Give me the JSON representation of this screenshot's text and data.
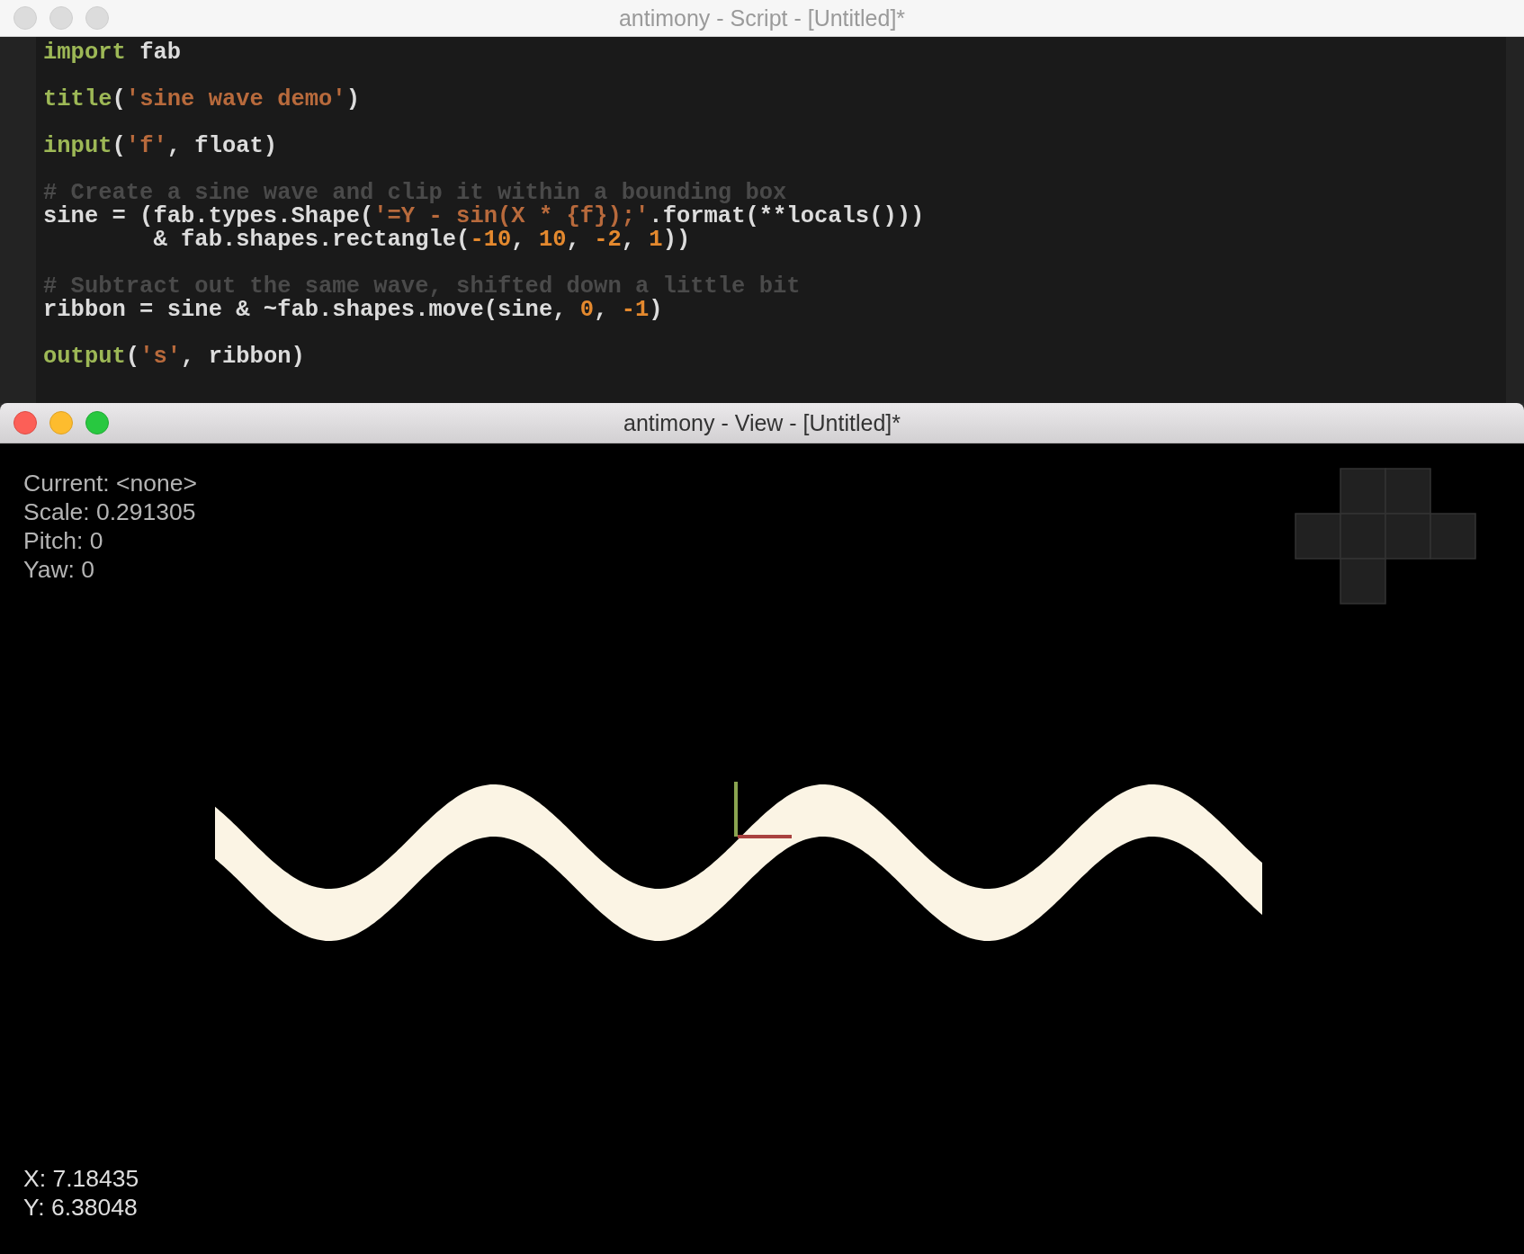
{
  "script_window": {
    "title": "antimony - Script - [Untitled]*",
    "active": false,
    "code_blocks": [
      {
        "lines": [
          {
            "tokens": [
              {
                "kind": "keyword",
                "text": "import"
              },
              {
                "kind": "plain",
                "text": " fab"
              }
            ]
          }
        ]
      },
      {
        "lines": [
          {
            "tokens": [
              {
                "kind": "keyword",
                "text": "title"
              },
              {
                "kind": "plain",
                "text": "("
              },
              {
                "kind": "string",
                "text": "'sine wave demo'"
              },
              {
                "kind": "plain",
                "text": ")"
              }
            ]
          }
        ]
      },
      {
        "lines": [
          {
            "tokens": [
              {
                "kind": "keyword",
                "text": "input"
              },
              {
                "kind": "plain",
                "text": "("
              },
              {
                "kind": "string",
                "text": "'f'"
              },
              {
                "kind": "plain",
                "text": ", float)"
              }
            ]
          }
        ]
      },
      {
        "lines": [
          {
            "tokens": [
              {
                "kind": "comment",
                "text": "# Create a sine wave and clip it within a bounding box"
              }
            ]
          },
          {
            "tokens": [
              {
                "kind": "plain",
                "text": "sine = (fab.types.Shape("
              },
              {
                "kind": "string",
                "text": "'=Y - sin(X * {f});'"
              },
              {
                "kind": "plain",
                "text": ".format(**locals()))"
              }
            ]
          },
          {
            "tokens": [
              {
                "kind": "plain",
                "text": "        & fab.shapes.rectangle("
              },
              {
                "kind": "number",
                "text": "-10"
              },
              {
                "kind": "plain",
                "text": ", "
              },
              {
                "kind": "number",
                "text": "10"
              },
              {
                "kind": "plain",
                "text": ", "
              },
              {
                "kind": "number",
                "text": "-2"
              },
              {
                "kind": "plain",
                "text": ", "
              },
              {
                "kind": "number",
                "text": "1"
              },
              {
                "kind": "plain",
                "text": "))"
              }
            ]
          }
        ]
      },
      {
        "lines": [
          {
            "tokens": [
              {
                "kind": "comment",
                "text": "# Subtract out the same wave, shifted down a little bit"
              }
            ]
          },
          {
            "tokens": [
              {
                "kind": "plain",
                "text": "ribbon = sine & ~fab.shapes.move(sine, "
              },
              {
                "kind": "number",
                "text": "0"
              },
              {
                "kind": "plain",
                "text": ", "
              },
              {
                "kind": "number",
                "text": "-1"
              },
              {
                "kind": "plain",
                "text": ")"
              }
            ]
          }
        ]
      },
      {
        "lines": [
          {
            "tokens": [
              {
                "kind": "keyword",
                "text": "output"
              },
              {
                "kind": "plain",
                "text": "("
              },
              {
                "kind": "string",
                "text": "'s'"
              },
              {
                "kind": "plain",
                "text": ", ribbon)"
              }
            ]
          }
        ]
      }
    ]
  },
  "view_window": {
    "title": "antimony - View - [Untitled]*",
    "active": true,
    "info_lines": [
      "Current: <none>",
      "Scale: 0.291305",
      "Pitch: 0",
      "Yaw: 0"
    ],
    "cursor_lines": [
      "X: 7.18435",
      "Y: 6.38048"
    ]
  }
}
